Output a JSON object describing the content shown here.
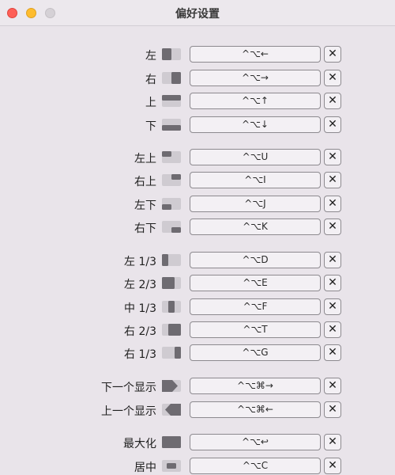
{
  "window": {
    "title": "偏好设置"
  },
  "colors": {
    "icon_fg": "#6e6b71",
    "icon_bg": "#cfcbd1"
  },
  "shortcuts": [
    {
      "label": "左",
      "shortcut": "^⌥←",
      "icon": "left-half-icon"
    },
    {
      "label": "右",
      "shortcut": "^⌥→",
      "icon": "right-half-icon"
    },
    {
      "label": "上",
      "shortcut": "^⌥↑",
      "icon": "top-half-icon"
    },
    {
      "label": "下",
      "shortcut": "^⌥↓",
      "icon": "bottom-half-icon"
    },
    {
      "label": "左上",
      "shortcut": "^⌥U",
      "icon": "top-left-quarter-icon"
    },
    {
      "label": "右上",
      "shortcut": "^⌥I",
      "icon": "top-right-quarter-icon"
    },
    {
      "label": "左下",
      "shortcut": "^⌥J",
      "icon": "bottom-left-quarter-icon"
    },
    {
      "label": "右下",
      "shortcut": "^⌥K",
      "icon": "bottom-right-quarter-icon"
    },
    {
      "label": "左 1/3",
      "shortcut": "^⌥D",
      "icon": "left-third-icon"
    },
    {
      "label": "左 2/3",
      "shortcut": "^⌥E",
      "icon": "left-two-thirds-icon"
    },
    {
      "label": "中 1/3",
      "shortcut": "^⌥F",
      "icon": "center-third-icon"
    },
    {
      "label": "右 2/3",
      "shortcut": "^⌥T",
      "icon": "right-two-thirds-icon"
    },
    {
      "label": "右 1/3",
      "shortcut": "^⌥G",
      "icon": "right-third-icon"
    },
    {
      "label": "下一个显示",
      "shortcut": "^⌥⌘→",
      "icon": "next-display-icon"
    },
    {
      "label": "上一个显示",
      "shortcut": "^⌥⌘←",
      "icon": "previous-display-icon"
    },
    {
      "label": "最大化",
      "shortcut": "^⌥↩",
      "icon": "maximize-icon"
    },
    {
      "label": "居中",
      "shortcut": "^⌥C",
      "icon": "center-icon"
    }
  ],
  "clear_label": "✕"
}
